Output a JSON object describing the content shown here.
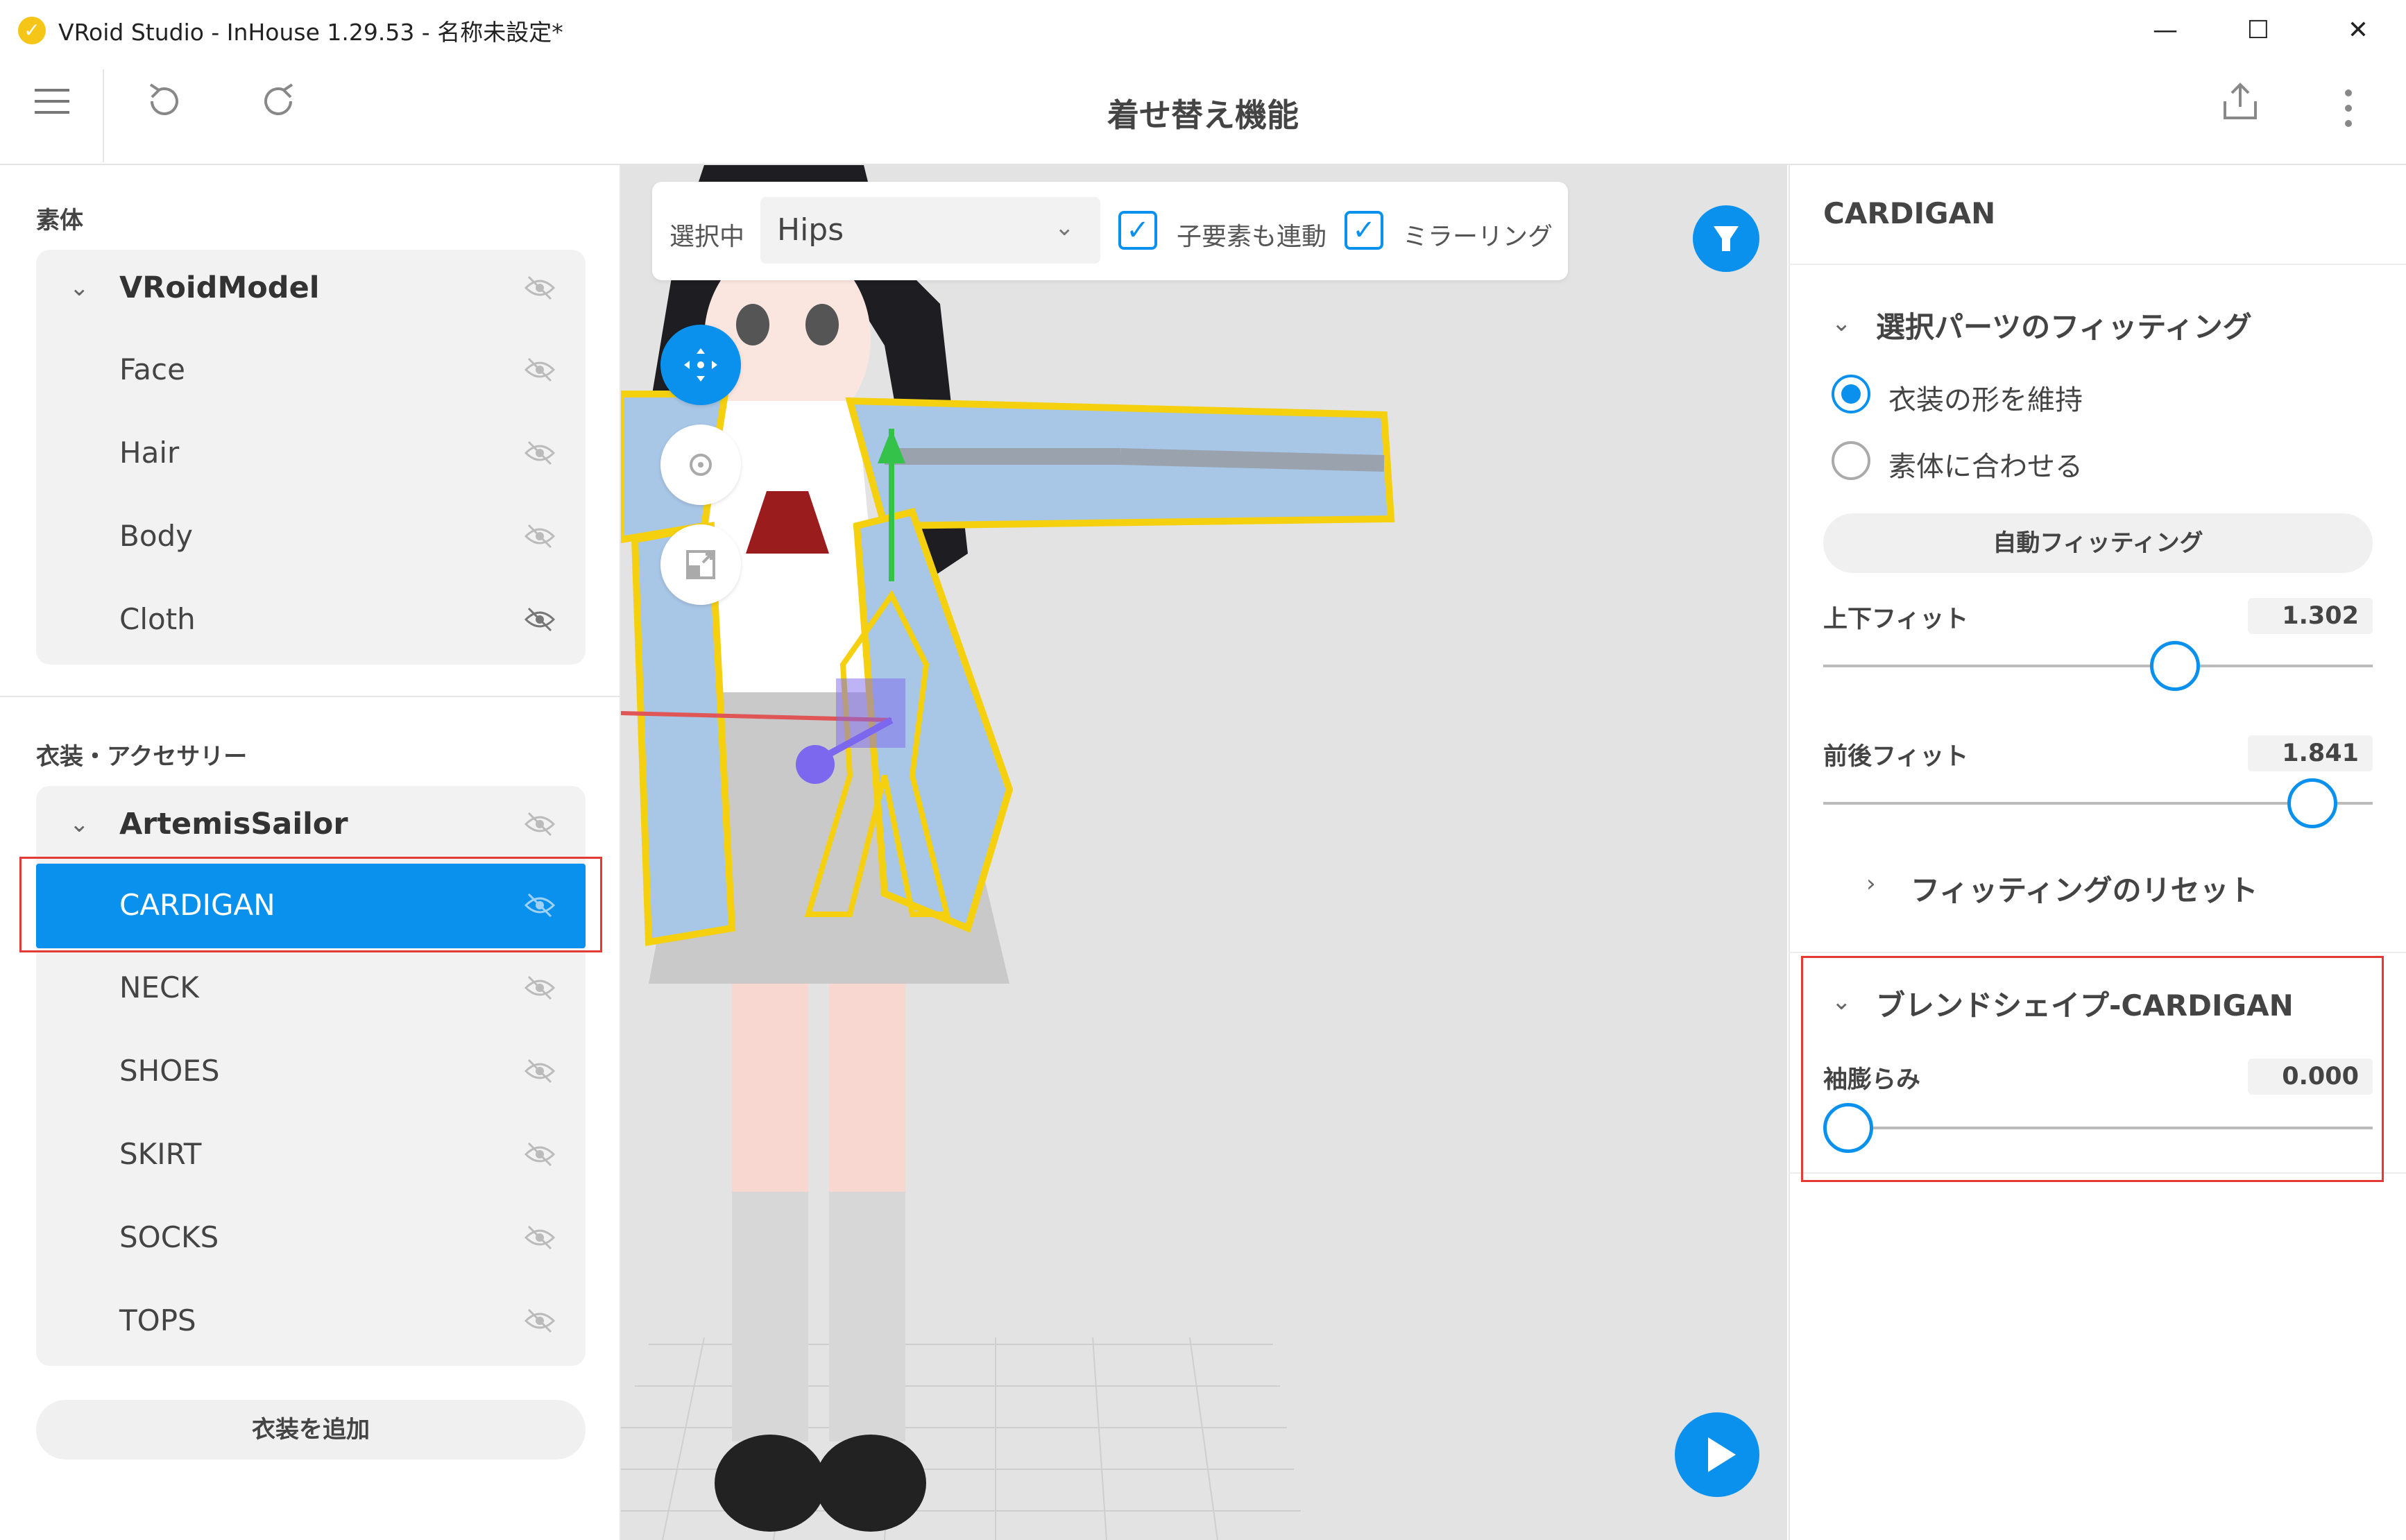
{
  "window": {
    "title": "VRoid Studio - InHouse 1.29.53 - 名称未設定*",
    "minimize": "—",
    "maximize": "☐",
    "close": "✕"
  },
  "toolbar": {
    "title": "着せ替え機能"
  },
  "left_panel": {
    "body_section_label": "素体",
    "body_tree": {
      "parent": "VRoidModel",
      "children": [
        "Face",
        "Hair",
        "Body",
        "Cloth"
      ]
    },
    "outfit_section_label": "衣装・アクセサリー",
    "outfit_tree": {
      "parent": "ArtemisSailor",
      "children": [
        "CARDIGAN",
        "NECK",
        "SHOES",
        "SKIRT",
        "SOCKS",
        "TOPS"
      ],
      "selected": "CARDIGAN"
    },
    "add_outfit_label": "衣装を追加"
  },
  "viewport": {
    "selecting_label": "選択中",
    "bone_select_value": "Hips",
    "link_children_label": "子要素も連動",
    "link_children_checked": true,
    "mirroring_label": "ミラーリング",
    "mirroring_checked": true,
    "accent_color": "#0a91ee"
  },
  "right_panel": {
    "title": "CARDIGAN",
    "fitting_section_title": "選択パーツのフィッティング",
    "fit_options": [
      "衣装の形を維持",
      "素体に合わせる"
    ],
    "fit_selected": "衣装の形を維持",
    "auto_fit_label": "自動フィッティング",
    "vertical_fit_label": "上下フィット",
    "vertical_fit_value": "1.302",
    "vertical_fit_level": 0.64,
    "depth_fit_label": "前後フィット",
    "depth_fit_value": "1.841",
    "depth_fit_level": 0.89,
    "reset_fitting_label": "フィッティングのリセット",
    "blendshape_section_title": "ブレンドシェイプ-CARDIGAN",
    "sleeve_puff_label": "袖膨らみ",
    "sleeve_puff_value": "0.000",
    "sleeve_puff_level": 0.0
  }
}
